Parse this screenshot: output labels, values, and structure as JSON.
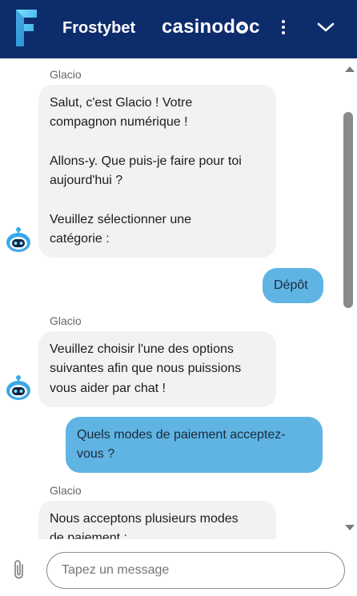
{
  "header": {
    "brand_name": "Frostybet",
    "partner_logo_prefix": "casinod",
    "partner_logo_suffix": "c",
    "background_color": "#0d2c6b",
    "logo_icon": "frostybet-f-logo",
    "menu_icon": "kebab-menu-icon",
    "collapse_icon": "chevron-down-icon"
  },
  "messages": [
    {
      "from": "bot",
      "sender": "Glacio",
      "lines": [
        "Salut, c'est Glacio ! Votre",
        "compagnon numérique !",
        "",
        "Allons-y. Que puis-je faire pour toi",
        "aujourd'hui ?",
        "",
        "Veuillez sélectionner une",
        "catégorie :"
      ]
    },
    {
      "from": "user",
      "text": "Dépôt"
    },
    {
      "from": "bot",
      "sender": "Glacio",
      "lines": [
        "Veuillez choisir l'une des options",
        "suivantes afin que nous puissions",
        "vous aider par chat !"
      ]
    },
    {
      "from": "user",
      "lines": [
        "Quels modes de paiement acceptez-",
        "vous ?"
      ]
    },
    {
      "from": "bot",
      "sender": "Glacio",
      "lines": [
        "Nous acceptons plusieurs modes",
        "de paiement :"
      ]
    }
  ],
  "composer": {
    "placeholder": "Tapez un message",
    "value": "",
    "attach_icon": "paperclip-icon"
  },
  "colors": {
    "bot_bubble": "#f1f2f4",
    "user_bubble": "#5fb4e3"
  }
}
